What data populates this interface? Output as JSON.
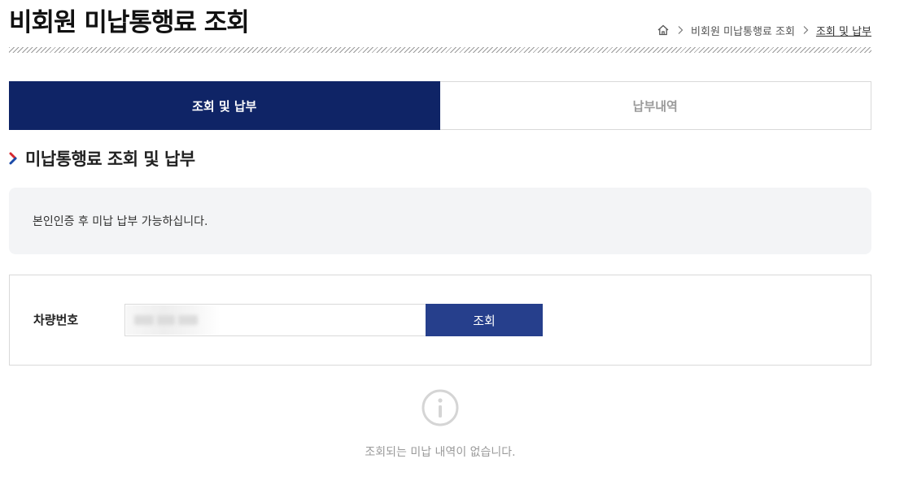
{
  "header": {
    "title": "비회원 미납통행료 조회",
    "breadcrumb": {
      "home_icon": "home-icon",
      "items": [
        "비회원 미납통행료 조회",
        "조회 및 납부"
      ]
    }
  },
  "tabs": [
    {
      "label": "조회 및 납부",
      "active": true
    },
    {
      "label": "납부내역",
      "active": false
    }
  ],
  "section": {
    "title": "미납통행료 조회 및 납부",
    "icon": "chevron-right-icon"
  },
  "notice": {
    "text": "본인인증 후 미납 납부 가능하십니다."
  },
  "form": {
    "vehicle_label": "차량번호",
    "vehicle_value": "",
    "search_label": "조회"
  },
  "empty_state": {
    "icon": "info-icon",
    "message": "조회되는 미납 내역이 없습니다."
  },
  "colors": {
    "active_tab": "#0f2466",
    "button": "#263f8c",
    "chevron_accent": "#d7282f"
  }
}
